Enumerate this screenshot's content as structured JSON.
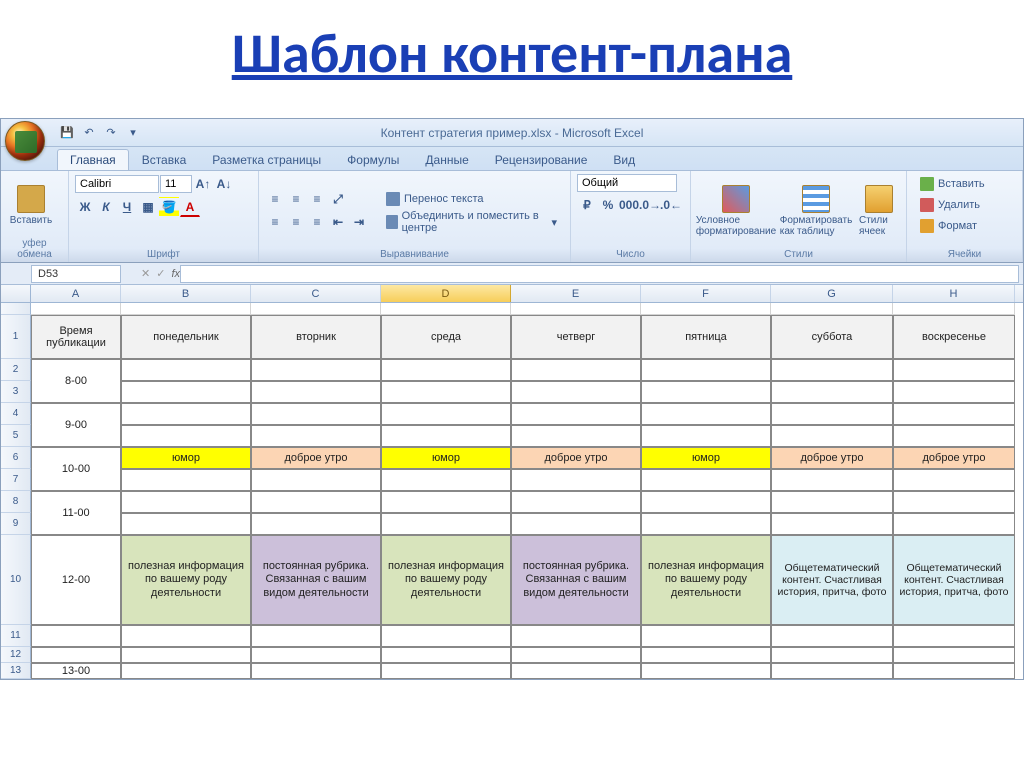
{
  "page_title": "Шаблон контент-плана",
  "window_title": "Контент стратегия пример.xlsx - Microsoft Excel",
  "ribbon_tabs": [
    "Главная",
    "Вставка",
    "Разметка страницы",
    "Формулы",
    "Данные",
    "Рецензирование",
    "Вид"
  ],
  "ribbon_groups": {
    "clipboard": {
      "label": "уфер обмена",
      "paste": "Вставить"
    },
    "font": {
      "label": "Шрифт",
      "name": "Calibri",
      "size": "11"
    },
    "alignment": {
      "label": "Выравнивание",
      "wrap": "Перенос текста",
      "merge": "Объединить и поместить в центре"
    },
    "number": {
      "label": "Число",
      "format": "Общий"
    },
    "styles": {
      "label": "Стили",
      "cond": "Условное форматирование",
      "table": "Форматировать как таблицу",
      "cell": "Стили ячеек"
    },
    "cells": {
      "label": "Ячейки",
      "insert": "Вставить",
      "delete": "Удалить",
      "format": "Формат"
    }
  },
  "name_box": "D53",
  "columns": [
    "A",
    "B",
    "C",
    "D",
    "E",
    "F",
    "G",
    "H"
  ],
  "row_numbers": [
    "",
    "1",
    "2",
    "3",
    "4",
    "5",
    "6",
    "7",
    "8",
    "9",
    "10",
    "11",
    "12",
    "13"
  ],
  "table": {
    "headers": [
      "Время публикации",
      "понедельник",
      "вторник",
      "среда",
      "четверг",
      "пятница",
      "суббота",
      "воскресенье"
    ],
    "times": [
      "8-00",
      "9-00",
      "10-00",
      "11-00",
      "12-00",
      "13-00"
    ],
    "row_10": {
      "b": "юмор",
      "c": "доброе утро",
      "d": "юмор",
      "e": "доброе утро",
      "f": "юмор",
      "g": "доброе утро",
      "h": "доброе утро"
    },
    "row_12": {
      "b": "полезная информация по вашему роду деятельности",
      "c": "постоянная рубрика. Связанная с вашим видом деятельности",
      "d": "полезная информация по вашему роду деятельности",
      "e": "постоянная рубрика. Связанная с вашим видом деятельности",
      "f": "полезная информация по вашему роду деятельности",
      "g": "Общетематический контент. Счастливая история, притча, фото",
      "h": "Общетематический контент. Счастливая история, притча, фото"
    }
  }
}
